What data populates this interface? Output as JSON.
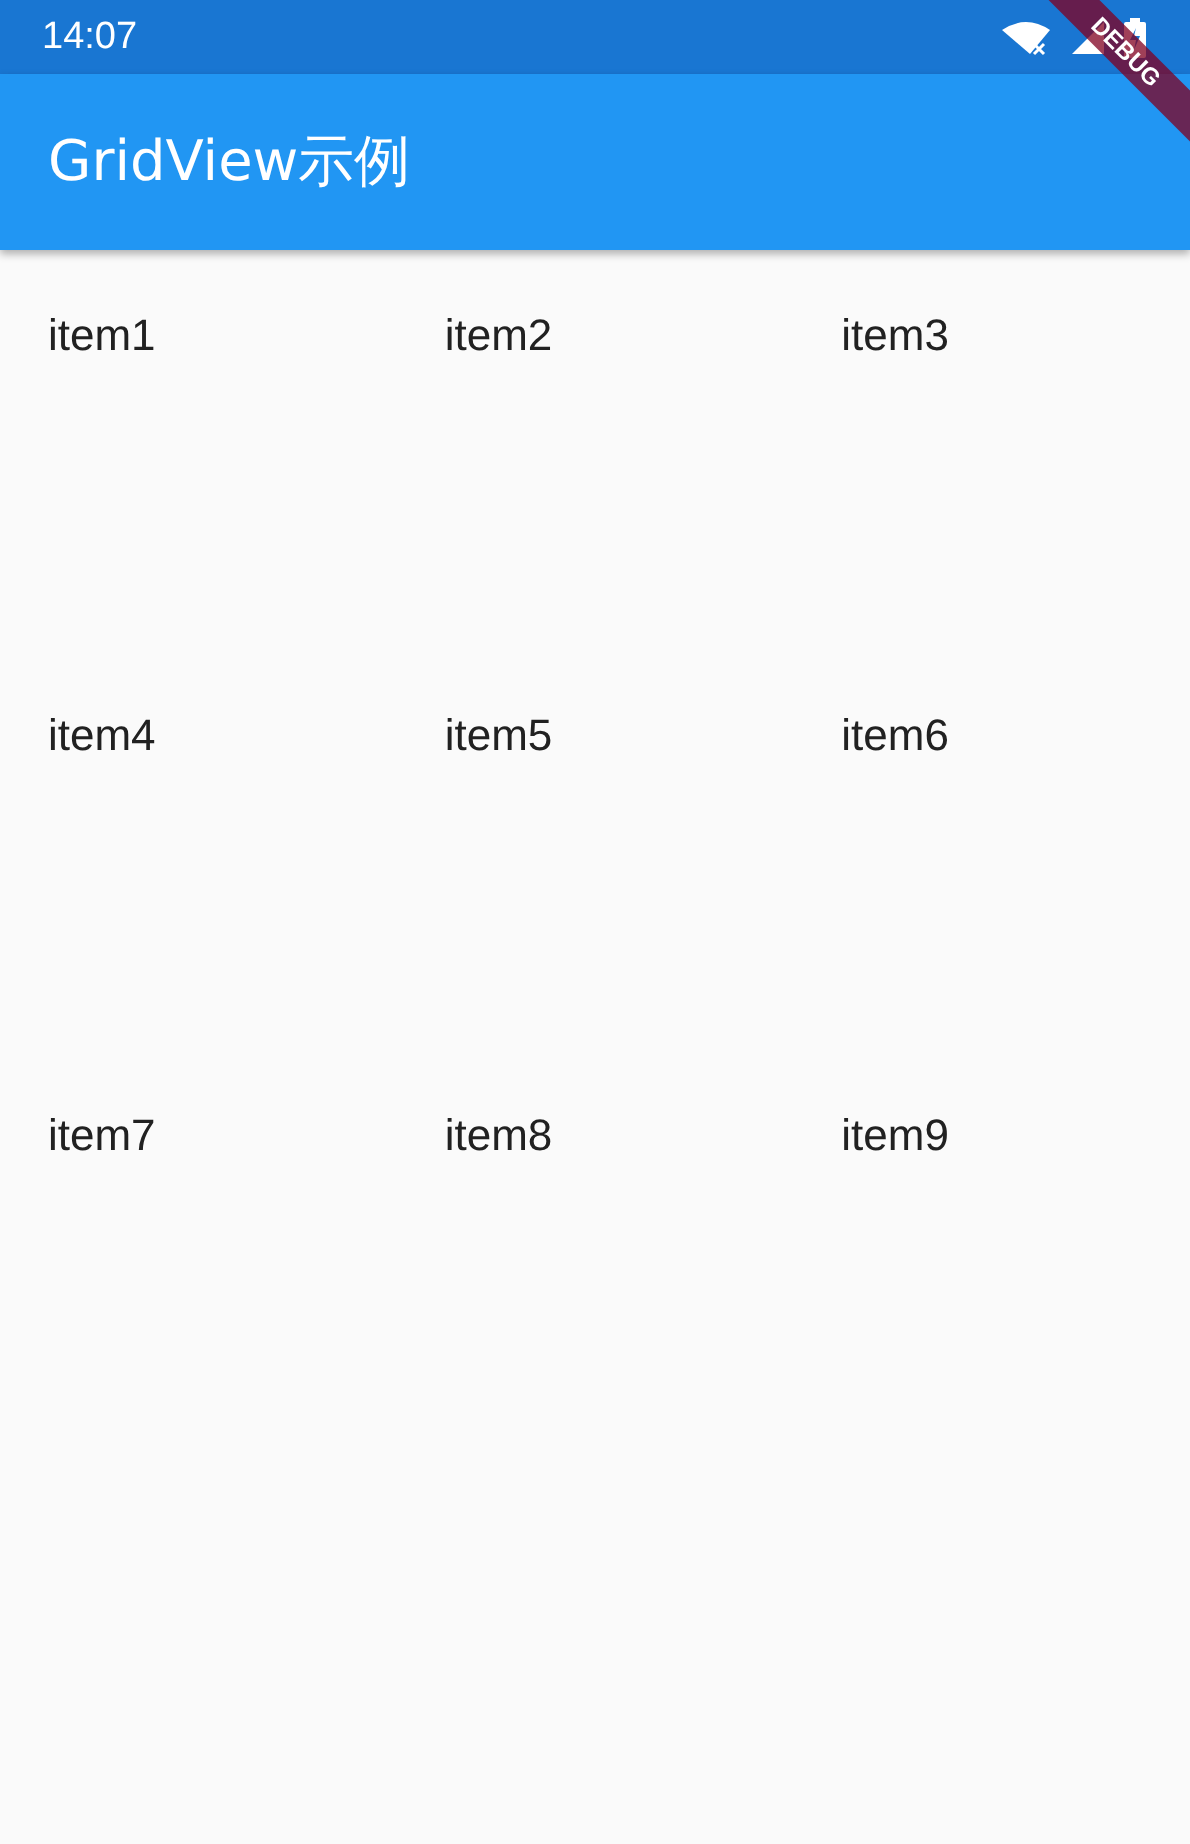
{
  "status_bar": {
    "time": "14:07"
  },
  "app_bar": {
    "title": "GridView示例"
  },
  "grid": {
    "items": [
      {
        "label": "item1"
      },
      {
        "label": "item2"
      },
      {
        "label": "item3"
      },
      {
        "label": "item4"
      },
      {
        "label": "item5"
      },
      {
        "label": "item6"
      },
      {
        "label": "item7"
      },
      {
        "label": "item8"
      },
      {
        "label": "item9"
      }
    ]
  },
  "debug_banner": {
    "label": "DEBUG"
  }
}
